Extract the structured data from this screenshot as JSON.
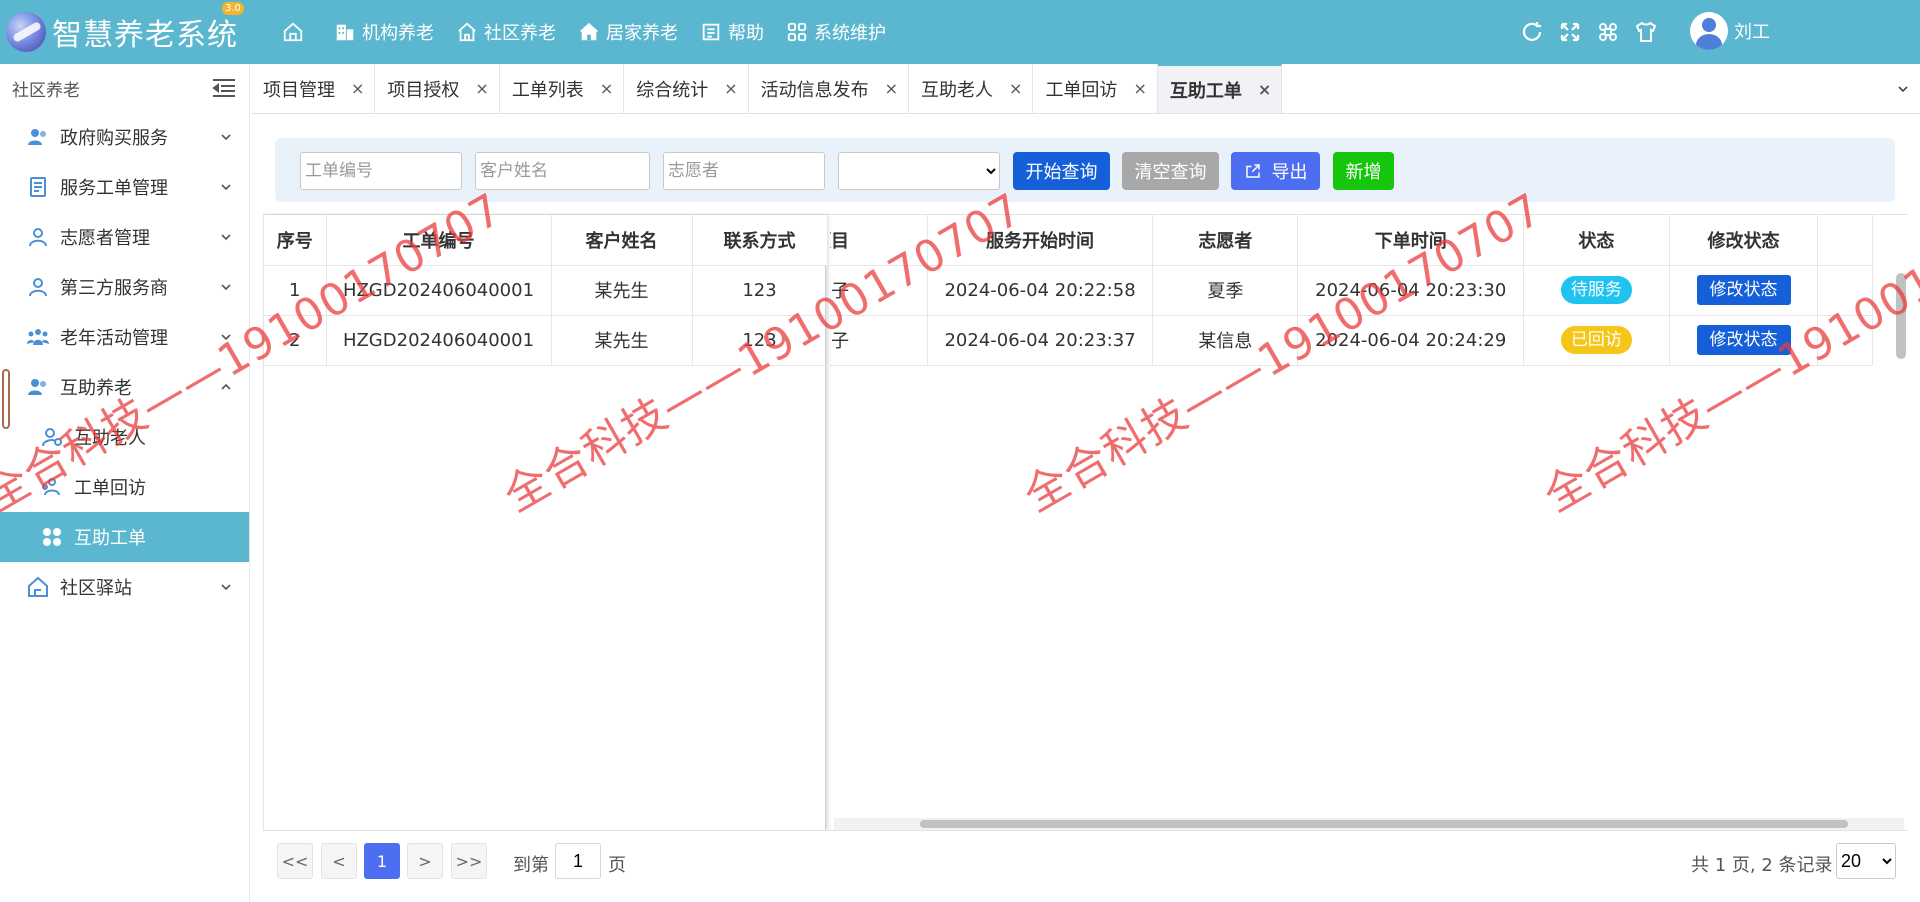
{
  "app": {
    "title": "智慧养老系统",
    "version": "3.0"
  },
  "topnav": [
    {
      "label": "机构养老"
    },
    {
      "label": "社区养老"
    },
    {
      "label": "居家养老"
    },
    {
      "label": "帮助"
    },
    {
      "label": "系统维护"
    }
  ],
  "user": {
    "name": "刘工"
  },
  "sidebar": {
    "title": "社区养老",
    "items": [
      {
        "label": "政府购买服务"
      },
      {
        "label": "服务工单管理"
      },
      {
        "label": "志愿者管理"
      },
      {
        "label": "第三方服务商"
      },
      {
        "label": "老年活动管理"
      },
      {
        "label": "互助养老"
      },
      {
        "label": "社区驿站"
      }
    ],
    "subitems": [
      {
        "label": "互助老人"
      },
      {
        "label": "工单回访"
      },
      {
        "label": "互助工单"
      }
    ]
  },
  "tabs": [
    {
      "label": "项目管理"
    },
    {
      "label": "项目授权"
    },
    {
      "label": "工单列表"
    },
    {
      "label": "综合统计"
    },
    {
      "label": "活动信息发布"
    },
    {
      "label": "互助老人"
    },
    {
      "label": "工单回访"
    },
    {
      "label": "互助工单"
    }
  ],
  "search": {
    "order_no_placeholder": "工单编号",
    "customer_placeholder": "客户姓名",
    "volunteer_placeholder": "志愿者",
    "select_value": "",
    "query_label": "开始查询",
    "clear_label": "清空查询",
    "export_label": "导出",
    "add_label": "新增"
  },
  "table": {
    "left_headers": [
      "序号",
      "工单编号",
      "客户姓名",
      "联系方式"
    ],
    "right_headers": [
      "务项目",
      "服务开始时间",
      "志愿者",
      "下单时间",
      "状态",
      "修改状态"
    ],
    "rows": [
      {
        "idx": "1",
        "order_no": "HZGD202406040001",
        "customer": "某先生",
        "phone": "123",
        "service": "铺被子",
        "start": "2024-06-04 20:22:58",
        "volunteer": "夏季",
        "ordered": "2024-06-04 20:23:30",
        "status": "待服务",
        "action": "修改状态"
      },
      {
        "idx": "2",
        "order_no": "HZGD202406040001",
        "customer": "某先生",
        "phone": "123",
        "service": "铺被子",
        "start": "2024-06-04 20:23:37",
        "volunteer": "某信息",
        "ordered": "2024-06-04 20:24:29",
        "status": "已回访",
        "action": "修改状态"
      }
    ]
  },
  "pager": {
    "first": "<<",
    "prev": "<",
    "current": "1",
    "next": ">",
    "last": ">>",
    "goto_prefix": "到第",
    "goto_value": "1",
    "goto_suffix": "页",
    "summary": "共 1 页, 2 条记录",
    "page_size": "20"
  },
  "watermark": {
    "text": "全合科技——19100170707"
  },
  "colors": {
    "primary": "#5ab7cf",
    "query": "#1560d9",
    "clear": "#a8a8a8",
    "export": "#4e6ef2",
    "add": "#16c60c",
    "status_wait": "#1fc3ef",
    "status_done": "#f5c518"
  }
}
